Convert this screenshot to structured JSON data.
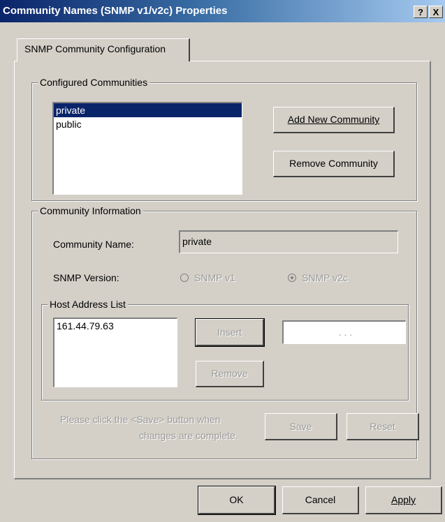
{
  "window": {
    "title": "Community Names (SNMP v1/v2c) Properties",
    "help_btn": "?",
    "close_btn": "X"
  },
  "tab": {
    "label": "SNMP Community Configuration"
  },
  "configured": {
    "group_label": "Configured Communities",
    "communities": [
      "private",
      "public"
    ],
    "selected": "private",
    "add_btn": "Add New Community",
    "remove_btn": "Remove Community"
  },
  "info": {
    "group_label": "Community Information",
    "name_label": "Community Name:",
    "name_value": "private",
    "version_label": "SNMP Version:",
    "v1_label": "SNMP v1",
    "v2c_label": "SNMP v2c",
    "selected_version": "SNMP v2c",
    "host": {
      "group_label": "Host Address List",
      "addresses": [
        "161.44.79.63"
      ],
      "insert_btn": "Insert",
      "remove_btn": "Remove",
      "ip_placeholder": ".       .       ."
    },
    "hint_line1": "Please click the <Save> button when",
    "hint_line2": "changes are complete.",
    "save_btn": "Save",
    "reset_btn": "Reset"
  },
  "footer": {
    "ok_btn": "OK",
    "cancel_btn": "Cancel",
    "apply_btn": "Apply"
  },
  "colors": {
    "face": "#d4d0c8",
    "title_start": "#0a246a",
    "title_end": "#a6caf0",
    "selection": "#0a246a",
    "disabled_text": "#9a9a9a"
  }
}
